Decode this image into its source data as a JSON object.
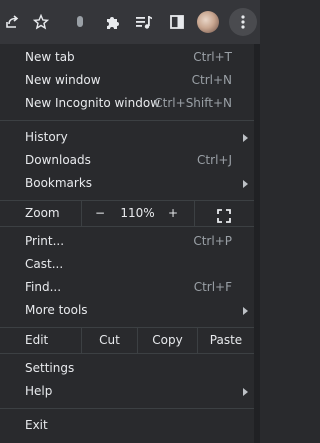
{
  "toolbar": {
    "icons": [
      "share-icon",
      "star-icon",
      "mic-icon",
      "extensions-puzzle-icon",
      "media-queue-icon",
      "side-panel-icon",
      "profile-avatar",
      "kebab-menu-icon"
    ]
  },
  "menu": {
    "new_tab": {
      "label": "New tab",
      "shortcut": "Ctrl+T"
    },
    "new_window": {
      "label": "New window",
      "shortcut": "Ctrl+N"
    },
    "new_incognito": {
      "label": "New Incognito window",
      "shortcut": "Ctrl+Shift+N"
    },
    "history": {
      "label": "History"
    },
    "downloads": {
      "label": "Downloads",
      "shortcut": "Ctrl+J"
    },
    "bookmarks": {
      "label": "Bookmarks"
    },
    "zoom": {
      "label": "Zoom",
      "minus": "−",
      "level": "110%",
      "plus": "+"
    },
    "print": {
      "label": "Print...",
      "shortcut": "Ctrl+P"
    },
    "cast": {
      "label": "Cast..."
    },
    "find": {
      "label": "Find...",
      "shortcut": "Ctrl+F"
    },
    "more_tools": {
      "label": "More tools"
    },
    "edit": {
      "label": "Edit",
      "cut": "Cut",
      "copy": "Copy",
      "paste": "Paste"
    },
    "settings": {
      "label": "Settings"
    },
    "help": {
      "label": "Help"
    },
    "exit": {
      "label": "Exit"
    }
  },
  "colors": {
    "menu_bg": "#292a2d",
    "toolbar_bg": "#35363a",
    "text": "#e8eaed",
    "shortcut_text": "#9aa0a6",
    "separator": "#3c4043"
  }
}
